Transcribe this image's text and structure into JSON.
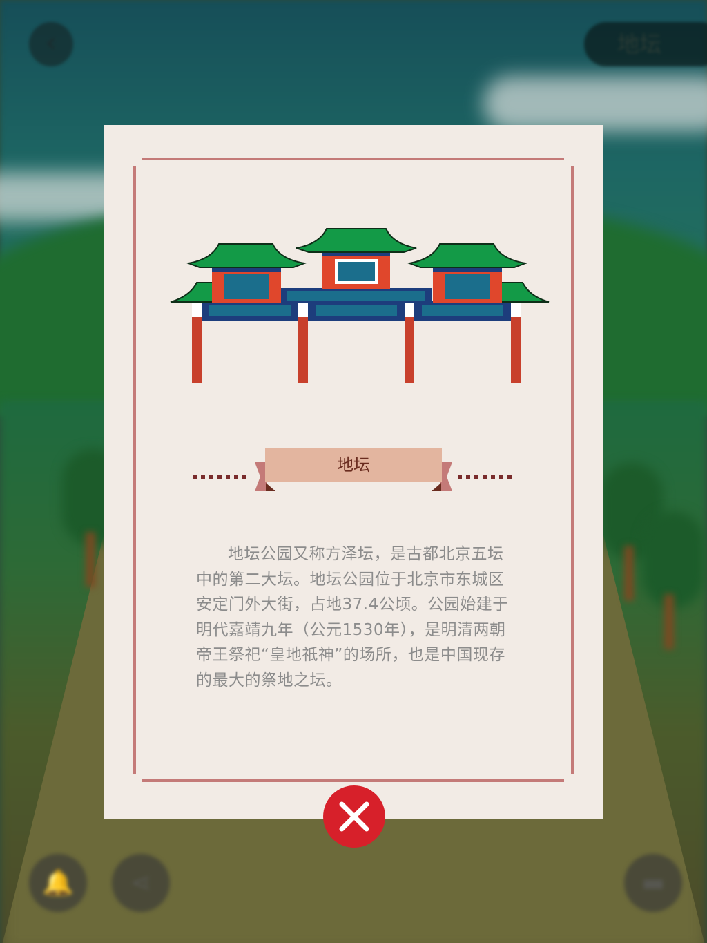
{
  "header": {
    "back_label": "‹",
    "title": "地坛"
  },
  "modal": {
    "title": "地坛",
    "description": "地坛公园又称方泽坛，是古都北京五坛中的第二大坛。地坛公园位于北京市东城区安定门外大街，占地37.4公顷。公园始建于明代嘉靖九年（公元1530年），是明清两朝帝王祭祀“皇地祇神”的场所，也是中国现存的最大的祭地之坛。",
    "illustration": "paifang-gate",
    "close_icon": "close-icon"
  },
  "bottom_bar": {
    "left_icon": "bell-icon",
    "share_icon": "share-icon",
    "right_icon": "card-icon"
  },
  "colors": {
    "card_background": "#f2ebe5",
    "frame_line": "#c47a78",
    "ribbon": "#e3b59f",
    "title_text": "#6a2c1f",
    "body_text": "#8c8c8c",
    "close_button": "#d7202a"
  }
}
